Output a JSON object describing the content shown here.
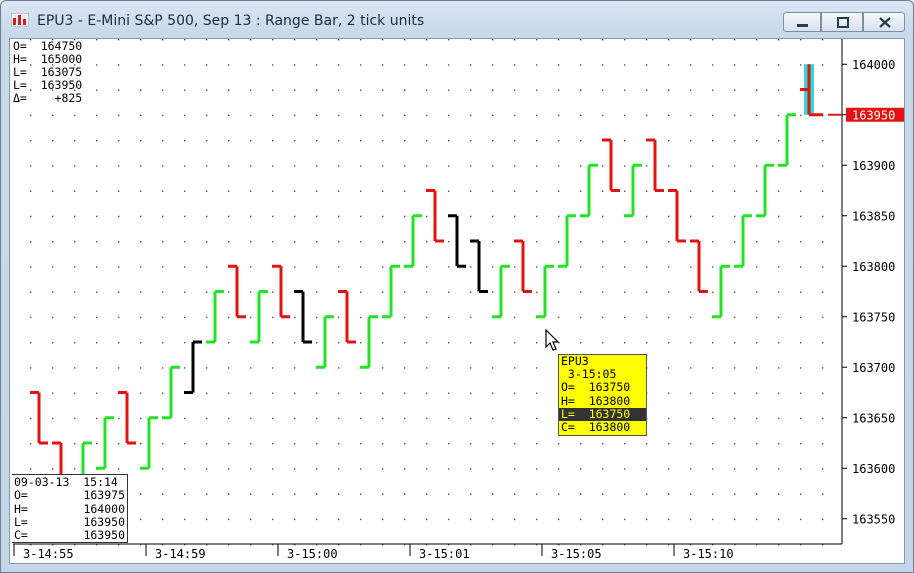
{
  "window": {
    "title": "EPU3 - E-Mini S&P 500, Sep 13 : Range Bar, 2 tick units",
    "icon": "chart-app-icon",
    "controls": [
      "minimize-icon",
      "maximize-icon",
      "close-icon"
    ]
  },
  "ohlc_summary": {
    "open": "O=  164750",
    "high": "H=  165000",
    "low": "L=  163075",
    "last": "L=  163950",
    "delta": "Δ=    +825"
  },
  "cursor_box": {
    "datetime": "09-03-13  15:14",
    "rows": [
      {
        "label": "O=",
        "value": "163975"
      },
      {
        "label": "H=",
        "value": "164000"
      },
      {
        "label": "L=",
        "value": "163950"
      },
      {
        "label": "C=",
        "value": "163950"
      }
    ]
  },
  "tooltip": {
    "symbol": "EPU3",
    "time": " 3-15:05",
    "open": "O=  163750",
    "high": "H=  163800",
    "low": "L=  163750",
    "close": "C=  163800"
  },
  "colors": {
    "up": "#22e522",
    "down": "#e31313",
    "neutral": "#000000",
    "last_bar_fill": "#2fd6d6",
    "price_marker": "#e31313",
    "tooltip_bg": "#ffff00"
  },
  "chart_data": {
    "type": "ohlc",
    "last_price": "163950",
    "y_ticks": [
      "164000",
      "163950",
      "163900",
      "163850",
      "163800",
      "163750",
      "163700",
      "163650",
      "163600",
      "163550"
    ],
    "ylim": [
      163525,
      164025
    ],
    "x_ticks": [
      "3-14:55",
      "3-14:59",
      "3-15:00",
      "3-15:01",
      "3-15:05",
      "3-15:10"
    ],
    "grid": "dotted",
    "bars": [
      {
        "open": 163675,
        "high": 163675,
        "low": 163625,
        "close": 163625,
        "dir": "down"
      },
      {
        "open": 163625,
        "high": 163625,
        "low": 163575,
        "close": 163575,
        "dir": "down"
      },
      {
        "open": 163575,
        "high": 163625,
        "low": 163575,
        "close": 163625,
        "dir": "up"
      },
      {
        "open": 163600,
        "high": 163650,
        "low": 163600,
        "close": 163650,
        "dir": "up"
      },
      {
        "open": 163675,
        "high": 163675,
        "low": 163625,
        "close": 163625,
        "dir": "down"
      },
      {
        "open": 163600,
        "high": 163650,
        "low": 163600,
        "close": 163650,
        "dir": "up"
      },
      {
        "open": 163650,
        "high": 163700,
        "low": 163650,
        "close": 163700,
        "dir": "up"
      },
      {
        "open": 163675,
        "high": 163725,
        "low": 163675,
        "close": 163725,
        "dir": "neutral"
      },
      {
        "open": 163725,
        "high": 163775,
        "low": 163725,
        "close": 163775,
        "dir": "up"
      },
      {
        "open": 163800,
        "high": 163800,
        "low": 163750,
        "close": 163750,
        "dir": "down"
      },
      {
        "open": 163725,
        "high": 163775,
        "low": 163725,
        "close": 163775,
        "dir": "up"
      },
      {
        "open": 163800,
        "high": 163800,
        "low": 163750,
        "close": 163750,
        "dir": "down"
      },
      {
        "open": 163775,
        "high": 163775,
        "low": 163725,
        "close": 163725,
        "dir": "neutral"
      },
      {
        "open": 163700,
        "high": 163750,
        "low": 163700,
        "close": 163750,
        "dir": "up"
      },
      {
        "open": 163775,
        "high": 163775,
        "low": 163725,
        "close": 163725,
        "dir": "down"
      },
      {
        "open": 163700,
        "high": 163750,
        "low": 163700,
        "close": 163750,
        "dir": "up"
      },
      {
        "open": 163750,
        "high": 163800,
        "low": 163750,
        "close": 163800,
        "dir": "up"
      },
      {
        "open": 163800,
        "high": 163850,
        "low": 163800,
        "close": 163850,
        "dir": "up"
      },
      {
        "open": 163875,
        "high": 163875,
        "low": 163825,
        "close": 163825,
        "dir": "down"
      },
      {
        "open": 163850,
        "high": 163850,
        "low": 163800,
        "close": 163800,
        "dir": "neutral"
      },
      {
        "open": 163825,
        "high": 163825,
        "low": 163775,
        "close": 163775,
        "dir": "neutral"
      },
      {
        "open": 163750,
        "high": 163800,
        "low": 163750,
        "close": 163800,
        "dir": "up"
      },
      {
        "open": 163825,
        "high": 163825,
        "low": 163775,
        "close": 163775,
        "dir": "down"
      },
      {
        "open": 163750,
        "high": 163800,
        "low": 163750,
        "close": 163800,
        "dir": "up"
      },
      {
        "open": 163800,
        "high": 163850,
        "low": 163800,
        "close": 163850,
        "dir": "up"
      },
      {
        "open": 163850,
        "high": 163900,
        "low": 163850,
        "close": 163900,
        "dir": "up"
      },
      {
        "open": 163925,
        "high": 163925,
        "low": 163875,
        "close": 163875,
        "dir": "down"
      },
      {
        "open": 163850,
        "high": 163900,
        "low": 163850,
        "close": 163900,
        "dir": "up"
      },
      {
        "open": 163925,
        "high": 163925,
        "low": 163875,
        "close": 163875,
        "dir": "down"
      },
      {
        "open": 163875,
        "high": 163875,
        "low": 163825,
        "close": 163825,
        "dir": "down"
      },
      {
        "open": 163825,
        "high": 163825,
        "low": 163775,
        "close": 163775,
        "dir": "down"
      },
      {
        "open": 163750,
        "high": 163800,
        "low": 163750,
        "close": 163800,
        "dir": "up"
      },
      {
        "open": 163800,
        "high": 163850,
        "low": 163800,
        "close": 163850,
        "dir": "up"
      },
      {
        "open": 163850,
        "high": 163900,
        "low": 163850,
        "close": 163900,
        "dir": "up"
      },
      {
        "open": 163900,
        "high": 163950,
        "low": 163900,
        "close": 163950,
        "dir": "up"
      },
      {
        "open": 163975,
        "high": 164000,
        "low": 163950,
        "close": 163950,
        "dir": "down"
      }
    ]
  }
}
